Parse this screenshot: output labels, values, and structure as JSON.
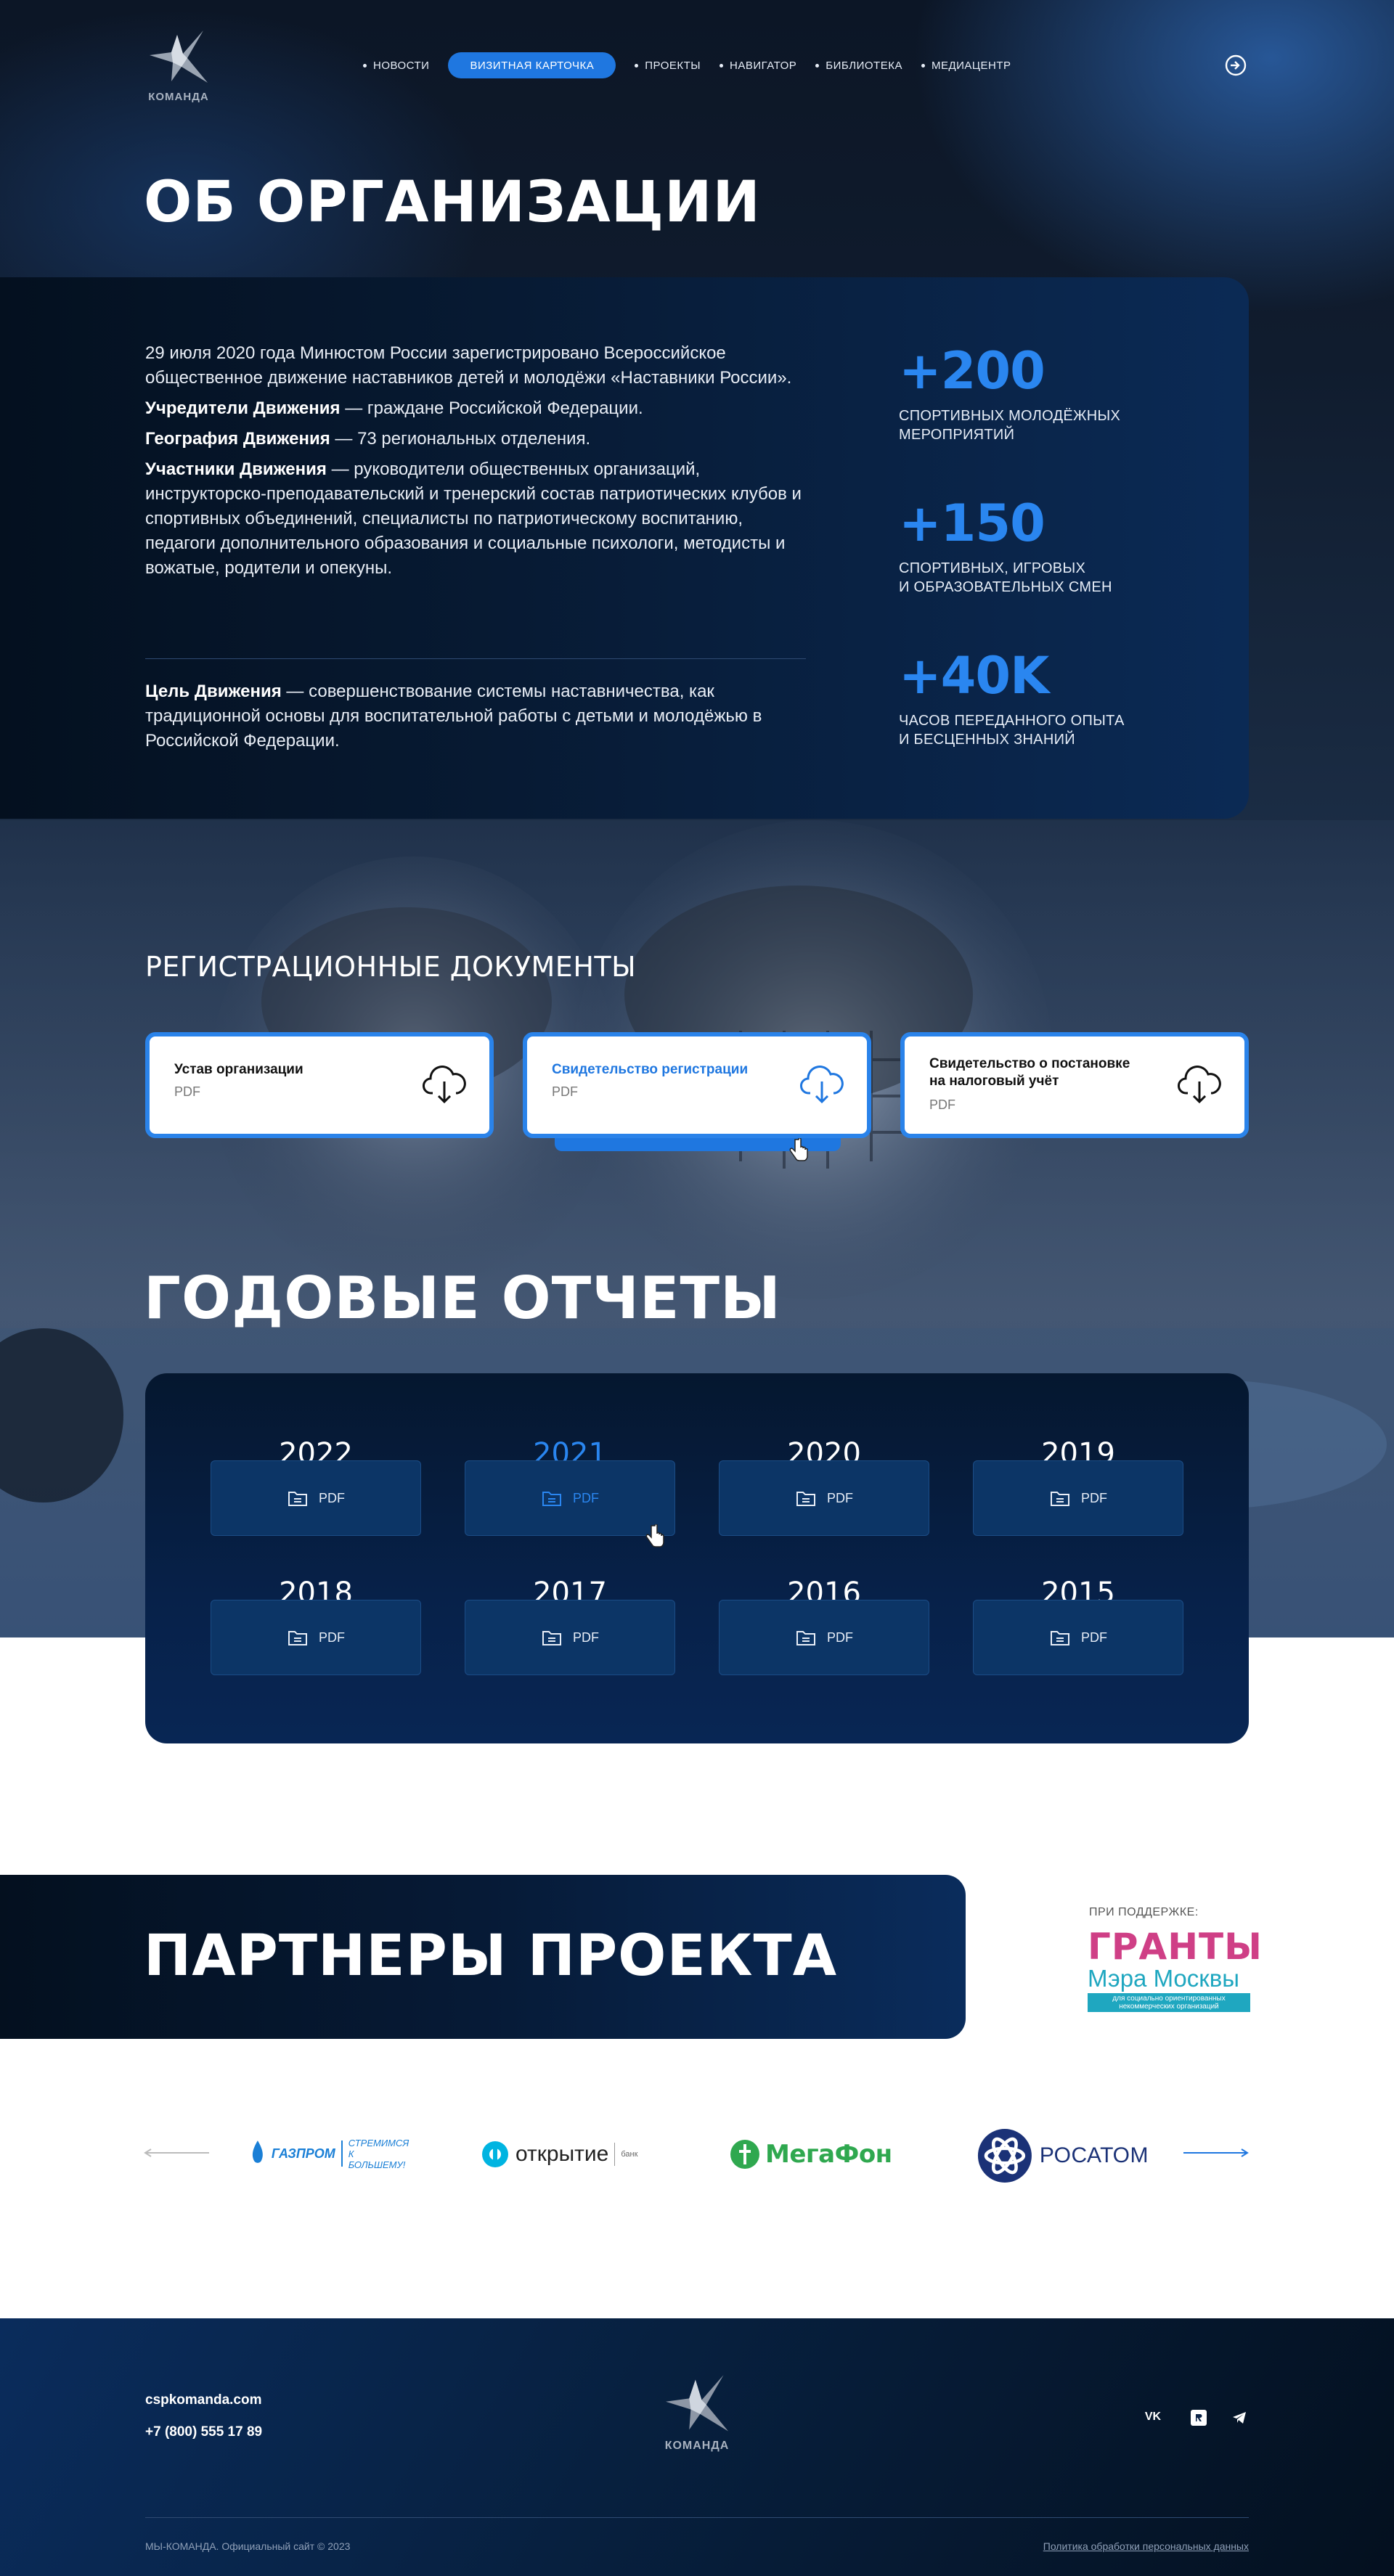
{
  "brand": {
    "logo_text": "КОМАНДА"
  },
  "nav": {
    "items": [
      {
        "label": "НОВОСТИ",
        "active": false
      },
      {
        "label": "ВИЗИТНАЯ КАРТОЧКА",
        "active": true
      },
      {
        "label": "ПРОЕКТЫ",
        "active": false
      },
      {
        "label": "НАВИГАТОР",
        "active": false
      },
      {
        "label": "БИБЛИОТЕКА",
        "active": false
      },
      {
        "label": "МЕДИАЦЕНТР",
        "active": false
      }
    ],
    "login_icon": "login-icon"
  },
  "about": {
    "title": "ОБ ОРГАНИЗАЦИИ",
    "p1": "29 июля 2020 года Минюстом России зарегистрировано Всероссийское общественное движение наставников детей и молодёжи «Наставники России».",
    "founders_label": "Учредители Движения",
    "founders_text": " — граждане Российской Федерации.",
    "geo_label": "География Движения",
    "geo_text": " — 73 региональных отделения.",
    "members_label": "Участники Движения",
    "members_text": " — руководители общественных организаций, инструкторско-преподавательский и тренерский состав патриотических клубов и спортивных объединений, специалисты по патриотическому воспитанию, педагоги дополнительного образования и социальные психологи, методисты и вожатые, родители и опекуны.",
    "goal_label": "Цель Движения",
    "goal_text": " — совершенствование системы наставничества, как традиционной основы для воспитательной работы с детьми и молодёжью в Российской Федерации.",
    "stats": [
      {
        "value": "+200",
        "label_1": "СПОРТИВНЫХ МОЛОДЁЖНЫХ",
        "label_2": "МЕРОПРИЯТИЙ"
      },
      {
        "value": "+150",
        "label_1": "СПОРТИВНЫХ, ИГРОВЫХ",
        "label_2": "И ОБРАЗОВАТЕЛЬНЫХ СМЕН"
      },
      {
        "value": "+40K",
        "label_1": "ЧАСОВ ПЕРЕДАННОГО ОПЫТА",
        "label_2": "И БЕСЦЕННЫХ ЗНАНИЙ"
      }
    ]
  },
  "documents": {
    "title": "РЕГИСТРАЦИОННЫЕ ДОКУМЕНТЫ",
    "items": [
      {
        "title_1": "Устав организации",
        "title_2": "",
        "type": "PDF",
        "color": "#111111"
      },
      {
        "title_1": "Свидетельство регистрации",
        "title_2": "",
        "type": "PDF",
        "color": "#1f77e0"
      },
      {
        "title_1": "Свидетельство о постановке",
        "title_2": "на налоговый учёт",
        "type": "PDF",
        "color": "#111111"
      }
    ]
  },
  "reports": {
    "title": "ГОДОВЫЕ ОТЧЕТЫ",
    "items": [
      {
        "year": "2022",
        "label": "PDF"
      },
      {
        "year": "2021",
        "label": "PDF",
        "highlight": true
      },
      {
        "year": "2020",
        "label": "PDF"
      },
      {
        "year": "2019",
        "label": "PDF"
      },
      {
        "year": "2018",
        "label": "PDF"
      },
      {
        "year": "2017",
        "label": "PDF"
      },
      {
        "year": "2016",
        "label": "PDF"
      },
      {
        "year": "2015",
        "label": "PDF"
      }
    ]
  },
  "partners": {
    "title": "ПАРТНЕРЫ ПРОЕКТА",
    "support_label": "ПРИ ПОДДЕРЖКЕ:",
    "grants_line1": "ГРАНТЫ",
    "grants_line2": "Мэра Москвы",
    "grants_line3": "для социально ориентированных",
    "grants_line4": "некоммерческих организаций",
    "logos": {
      "gazprom_1": "ГАЗПРОМ",
      "gazprom_2": "СТРЕМИМСЯ",
      "gazprom_3": "К БОЛЬШЕМУ!",
      "otkritie": "открытие",
      "otkritie_sub": "банк",
      "megafon": "МегаФон",
      "rosatom": "РОСАТОМ"
    }
  },
  "footer": {
    "site": "cspkomanda.com",
    "phone": "+7 (800) 555 17 89",
    "copyright": "МЫ-КОМАНДА. Официальный сайт © 2023",
    "privacy": "Политика обработки персональных данных",
    "socials": [
      "vk-icon",
      "rutube-icon",
      "telegram-icon"
    ]
  },
  "colors": {
    "accent": "#1f77e0",
    "dark": "#04101f"
  }
}
